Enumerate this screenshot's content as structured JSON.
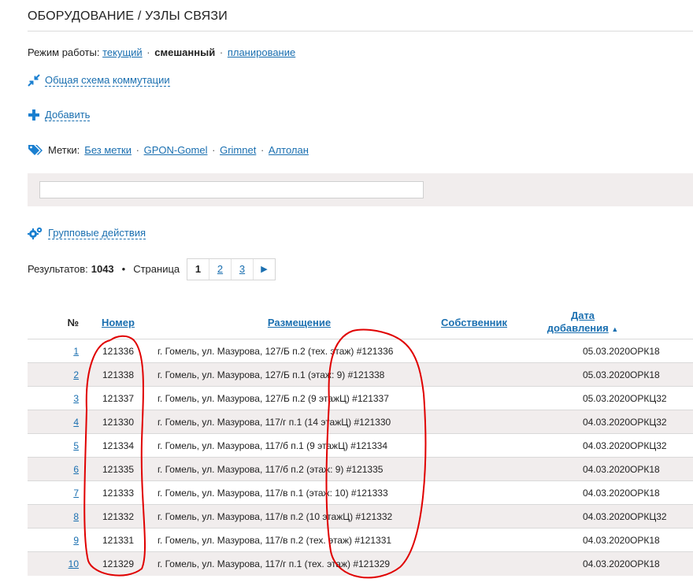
{
  "page": {
    "title": "ОБОРУДОВАНИЕ / УЗЛЫ СВЯЗИ"
  },
  "mode": {
    "label": "Режим работы:",
    "options": [
      "текущий",
      "смешанный",
      "планирование"
    ],
    "separator": "·"
  },
  "actions": {
    "scheme_label": "Общая схема коммутации",
    "add_label": "Добавить",
    "group_label": "Групповые действия"
  },
  "tags": {
    "label": "Метки:",
    "items": [
      "Без метки",
      "GPON-Gomel",
      "Grimnet",
      "Алтолан"
    ],
    "separator": "·"
  },
  "filter": {
    "value": "",
    "placeholder": ""
  },
  "results": {
    "label": "Результатов:",
    "count": "1043",
    "dot": "•",
    "page_label": "Страница",
    "pages": [
      "1",
      "2",
      "3"
    ],
    "current_page": "1",
    "next_icon": "triangle-right-icon"
  },
  "table": {
    "headers": {
      "no": "№",
      "number": "Номер",
      "placement": "Размещение",
      "owner": "Собственник",
      "date_line1": "Дата",
      "date_line2": "добавления",
      "sort_icon": "▲"
    },
    "rows": [
      {
        "idx": "1",
        "num": "121336",
        "place": "г. Гомель, ул. Мазурова, 127/Б п.2 (тех. этаж) #121336",
        "owner": "",
        "date": "05.03.2020",
        "model": "ОРК18"
      },
      {
        "idx": "2",
        "num": "121338",
        "place": "г. Гомель, ул. Мазурова, 127/Б п.1 (этаж: 9) #121338",
        "owner": "",
        "date": "05.03.2020",
        "model": "ОРК18"
      },
      {
        "idx": "3",
        "num": "121337",
        "place": "г. Гомель, ул. Мазурова, 127/Б п.2 (9 этажЦ) #121337",
        "owner": "",
        "date": "05.03.2020",
        "model": "ОРКЦ32"
      },
      {
        "idx": "4",
        "num": "121330",
        "place": "г. Гомель, ул. Мазурова, 117/г п.1 (14 этажЦ) #121330",
        "owner": "",
        "date": "04.03.2020",
        "model": "ОРКЦ32"
      },
      {
        "idx": "5",
        "num": "121334",
        "place": "г. Гомель, ул. Мазурова, 117/б п.1 (9 этажЦ) #121334",
        "owner": "",
        "date": "04.03.2020",
        "model": "ОРКЦ32"
      },
      {
        "idx": "6",
        "num": "121335",
        "place": "г. Гомель, ул. Мазурова, 117/б п.2 (этаж: 9) #121335",
        "owner": "",
        "date": "04.03.2020",
        "model": "ОРК18"
      },
      {
        "idx": "7",
        "num": "121333",
        "place": "г. Гомель, ул. Мазурова, 117/в п.1 (этаж: 10) #121333",
        "owner": "",
        "date": "04.03.2020",
        "model": "ОРК18"
      },
      {
        "idx": "8",
        "num": "121332",
        "place": "г. Гомель, ул. Мазурова, 117/в п.2 (10 этажЦ) #121332",
        "owner": "",
        "date": "04.03.2020",
        "model": "ОРКЦ32"
      },
      {
        "idx": "9",
        "num": "121331",
        "place": "г. Гомель, ул. Мазурова, 117/в п.2 (тех. этаж) #121331",
        "owner": "",
        "date": "04.03.2020",
        "model": "ОРК18"
      },
      {
        "idx": "10",
        "num": "121329",
        "place": "г. Гомель, ул. Мазурова, 117/г п.1 (тех. этаж) #121329",
        "owner": "",
        "date": "04.03.2020",
        "model": "ОРК18"
      }
    ]
  },
  "colors": {
    "link": "#1a6fb0",
    "stripe": "#f1eded",
    "annotation": "#e00000"
  }
}
